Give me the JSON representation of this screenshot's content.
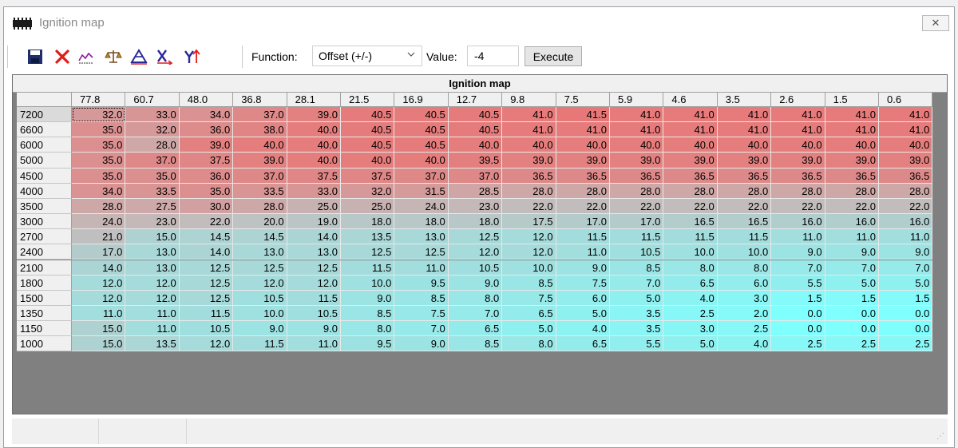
{
  "window": {
    "title": "Ignition map",
    "close_glyph": "✕"
  },
  "toolbar": {
    "buttons": [
      {
        "name": "save-icon",
        "color": "#1f2f6b"
      },
      {
        "name": "delete-icon",
        "color": "#e21b1b"
      },
      {
        "name": "graph-icon",
        "color": "#8b1c9e"
      },
      {
        "name": "balance-icon",
        "color": "#7a4a1a"
      },
      {
        "name": "triangle-icon",
        "color": "#2a2a9a"
      },
      {
        "name": "x-axis-icon",
        "color": "#2a2a9a"
      },
      {
        "name": "y-axis-icon",
        "color": "#2a2a9a"
      }
    ],
    "function_label": "Function:",
    "function_value": "Offset (+/-)",
    "value_label": "Value:",
    "value_input": "-4",
    "execute_label": "Execute"
  },
  "grid": {
    "title": "Ignition map",
    "columns": [
      "77.8",
      "60.7",
      "48.0",
      "36.8",
      "28.1",
      "21.5",
      "16.9",
      "12.7",
      "9.8",
      "7.5",
      "5.9",
      "4.6",
      "3.5",
      "2.6",
      "1.5",
      "0.6"
    ],
    "rows": [
      {
        "label": "7200",
        "values": [
          "32.0",
          "33.0",
          "34.0",
          "37.0",
          "39.0",
          "40.5",
          "40.5",
          "40.5",
          "41.0",
          "41.5",
          "41.0",
          "41.0",
          "41.0",
          "41.0",
          "41.0",
          "41.0"
        ]
      },
      {
        "label": "6600",
        "values": [
          "35.0",
          "32.0",
          "36.0",
          "38.0",
          "40.0",
          "40.5",
          "40.5",
          "40.5",
          "41.0",
          "41.0",
          "41.0",
          "41.0",
          "41.0",
          "41.0",
          "41.0",
          "41.0"
        ]
      },
      {
        "label": "6000",
        "values": [
          "35.0",
          "28.0",
          "39.0",
          "40.0",
          "40.0",
          "40.5",
          "40.5",
          "40.0",
          "40.0",
          "40.0",
          "40.0",
          "40.0",
          "40.0",
          "40.0",
          "40.0",
          "40.0"
        ]
      },
      {
        "label": "5000",
        "values": [
          "35.0",
          "37.0",
          "37.5",
          "39.0",
          "40.0",
          "40.0",
          "40.0",
          "39.5",
          "39.0",
          "39.0",
          "39.0",
          "39.0",
          "39.0",
          "39.0",
          "39.0",
          "39.0"
        ]
      },
      {
        "label": "4500",
        "values": [
          "35.0",
          "35.0",
          "36.0",
          "37.0",
          "37.5",
          "37.5",
          "37.0",
          "37.0",
          "36.5",
          "36.5",
          "36.5",
          "36.5",
          "36.5",
          "36.5",
          "36.5",
          "36.5"
        ]
      },
      {
        "label": "4000",
        "values": [
          "34.0",
          "33.5",
          "35.0",
          "33.5",
          "33.0",
          "32.0",
          "31.5",
          "28.5",
          "28.0",
          "28.0",
          "28.0",
          "28.0",
          "28.0",
          "28.0",
          "28.0",
          "28.0"
        ]
      },
      {
        "label": "3500",
        "values": [
          "28.0",
          "27.5",
          "30.0",
          "28.0",
          "25.0",
          "25.0",
          "24.0",
          "23.0",
          "22.0",
          "22.0",
          "22.0",
          "22.0",
          "22.0",
          "22.0",
          "22.0",
          "22.0"
        ]
      },
      {
        "label": "3000",
        "values": [
          "24.0",
          "23.0",
          "22.0",
          "20.0",
          "19.0",
          "18.0",
          "18.0",
          "18.0",
          "17.5",
          "17.0",
          "17.0",
          "16.5",
          "16.5",
          "16.0",
          "16.0",
          "16.0"
        ]
      },
      {
        "label": "2700",
        "values": [
          "21.0",
          "15.0",
          "14.5",
          "14.5",
          "14.0",
          "13.5",
          "13.0",
          "12.5",
          "12.0",
          "11.5",
          "11.5",
          "11.5",
          "11.5",
          "11.0",
          "11.0",
          "11.0"
        ]
      },
      {
        "label": "2400",
        "values": [
          "17.0",
          "13.0",
          "14.0",
          "13.0",
          "13.0",
          "12.5",
          "12.5",
          "12.0",
          "12.0",
          "11.0",
          "10.5",
          "10.0",
          "10.0",
          "9.0",
          "9.0",
          "9.0"
        ]
      },
      {
        "label": "2100",
        "values": [
          "14.0",
          "13.0",
          "12.5",
          "12.5",
          "12.5",
          "11.5",
          "11.0",
          "10.5",
          "10.0",
          "9.0",
          "8.5",
          "8.0",
          "8.0",
          "7.0",
          "7.0",
          "7.0"
        ]
      },
      {
        "label": "1800",
        "values": [
          "12.0",
          "12.0",
          "12.5",
          "12.0",
          "12.0",
          "10.0",
          "9.5",
          "9.0",
          "8.5",
          "7.5",
          "7.0",
          "6.5",
          "6.0",
          "5.5",
          "5.0",
          "5.0"
        ]
      },
      {
        "label": "1500",
        "values": [
          "12.0",
          "12.0",
          "12.5",
          "10.5",
          "11.5",
          "9.0",
          "8.5",
          "8.0",
          "7.5",
          "6.0",
          "5.0",
          "4.0",
          "3.0",
          "1.5",
          "1.5",
          "1.5"
        ]
      },
      {
        "label": "1350",
        "values": [
          "11.0",
          "11.0",
          "11.5",
          "10.0",
          "10.5",
          "8.5",
          "7.5",
          "7.0",
          "6.5",
          "5.0",
          "3.5",
          "2.5",
          "2.0",
          "0.0",
          "0.0",
          "0.0"
        ]
      },
      {
        "label": "1150",
        "values": [
          "15.0",
          "11.0",
          "10.5",
          "9.0",
          "9.0",
          "8.0",
          "7.0",
          "6.5",
          "5.0",
          "4.0",
          "3.5",
          "3.0",
          "2.5",
          "0.0",
          "0.0",
          "0.0"
        ]
      },
      {
        "label": "1000",
        "values": [
          "15.0",
          "13.5",
          "12.0",
          "11.5",
          "11.0",
          "9.5",
          "9.0",
          "8.5",
          "8.0",
          "6.5",
          "5.5",
          "5.0",
          "4.0",
          "2.5",
          "2.5",
          "2.5"
        ]
      }
    ],
    "selected_row": 0,
    "selected_col": 0
  }
}
